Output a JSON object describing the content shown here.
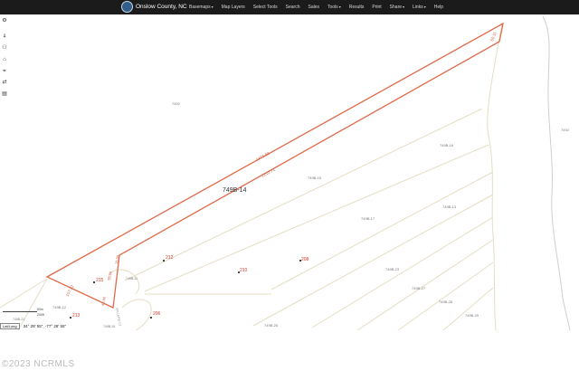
{
  "header": {
    "title": "Onslow County, NC",
    "menu": [
      {
        "label": "Basemaps",
        "dropdown": true
      },
      {
        "label": "Map Layers",
        "dropdown": false
      },
      {
        "label": "Select Tools",
        "dropdown": false
      },
      {
        "label": "Search",
        "dropdown": false
      },
      {
        "label": "Sales",
        "dropdown": false
      },
      {
        "label": "Tools",
        "dropdown": true
      },
      {
        "label": "Results",
        "dropdown": false
      },
      {
        "label": "Print",
        "dropdown": false
      },
      {
        "label": "Share",
        "dropdown": true
      },
      {
        "label": "Links",
        "dropdown": true
      },
      {
        "label": "Help",
        "dropdown": false
      }
    ]
  },
  "map": {
    "parcel_highlight_color": "#e06a4a",
    "selected_parcel": "749B-14",
    "dimension_labels": [
      "1471.58",
      "1212.71",
      "60.11",
      "157.32",
      "45.00",
      "35.00",
      "35.00"
    ],
    "parcel_labels": [
      "749B-14",
      "749B-15",
      "749B-17",
      "749B-16",
      "749B-23",
      "749B-27",
      "749B-28",
      "749B-29",
      "749B-12",
      "749B-11",
      "749B-26",
      "749B-13",
      "749B-10",
      "749B-21",
      "7492",
      "7492"
    ],
    "address_labels": [
      "212",
      "210",
      "208",
      "215",
      "213",
      "206"
    ],
    "road_label": "WILLARD CT"
  },
  "tools": [
    {
      "icon": "gear-icon"
    },
    {
      "icon": "pin-icon"
    },
    {
      "icon": "binoculars-icon"
    },
    {
      "icon": "home-icon"
    },
    {
      "icon": "location-icon"
    },
    {
      "icon": "share-icon"
    },
    {
      "icon": "trash-icon"
    }
  ],
  "scale": {
    "top": "60m",
    "bottom": "200ft"
  },
  "coords": {
    "mode": "Lat/Long",
    "value": "34° 28' 55\", -77° 28' 55\""
  },
  "watermark": "©2023 NCRMLS"
}
